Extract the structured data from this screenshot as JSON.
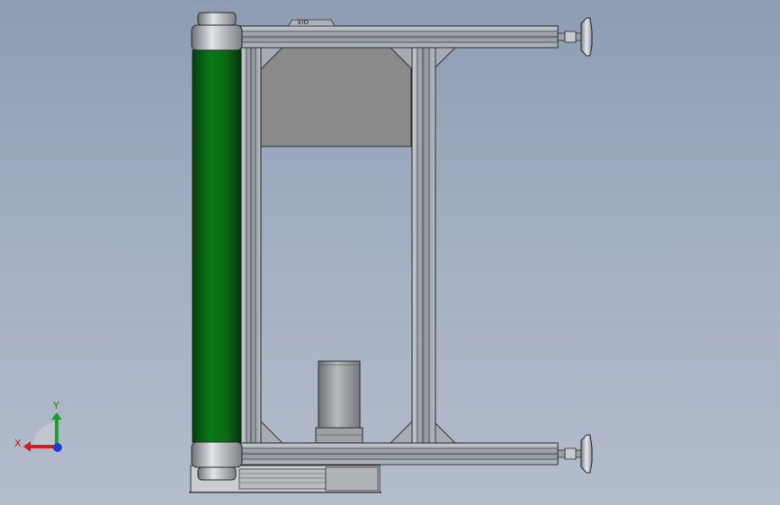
{
  "view": {
    "background_top": "#8e9db4",
    "background_bottom": "#b3bccb"
  },
  "model": {
    "roller_color": "#0b6b14",
    "frame_color": "#9ea4ac",
    "panel_color": "#8a8a8a",
    "motor_color": "#8f9296",
    "top_marking": "EIO"
  },
  "triad": {
    "x_label": "X",
    "y_label": "Y",
    "x_color": "#d11f1f",
    "y_color": "#1e9e2a",
    "z_color": "#1d3bd6"
  }
}
